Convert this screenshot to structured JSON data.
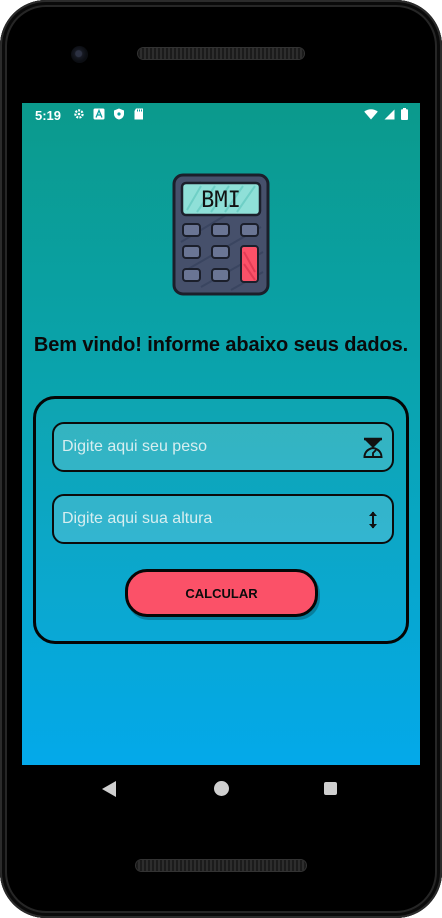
{
  "status_bar": {
    "time": "5:19",
    "left_icons": [
      "settings-gear-icon",
      "font-a-icon",
      "shield-icon",
      "sd-card-icon"
    ],
    "right_icons": [
      "wifi-icon",
      "signal-icon",
      "battery-icon"
    ]
  },
  "logo": {
    "text": "BMI",
    "icon": "calculator-icon"
  },
  "welcome": {
    "title": "Bem vindo! informe abaixo seus dados."
  },
  "form": {
    "weight": {
      "placeholder": "Digite aqui seu peso",
      "value": "",
      "icon": "scale-icon"
    },
    "height": {
      "placeholder": "Digite aqui sua altura",
      "value": "",
      "icon": "vertical-arrows-icon"
    },
    "calculate_label": "CALCULAR"
  },
  "nav": {
    "back": "back-icon",
    "home": "home-icon",
    "recents": "recents-icon"
  },
  "colors": {
    "gradient_top": "#0b9a8c",
    "gradient_bottom": "#04a9ea",
    "button": "#fb5168",
    "calc_key": "#fb5168",
    "calc_screen": "#8fe0d8"
  }
}
